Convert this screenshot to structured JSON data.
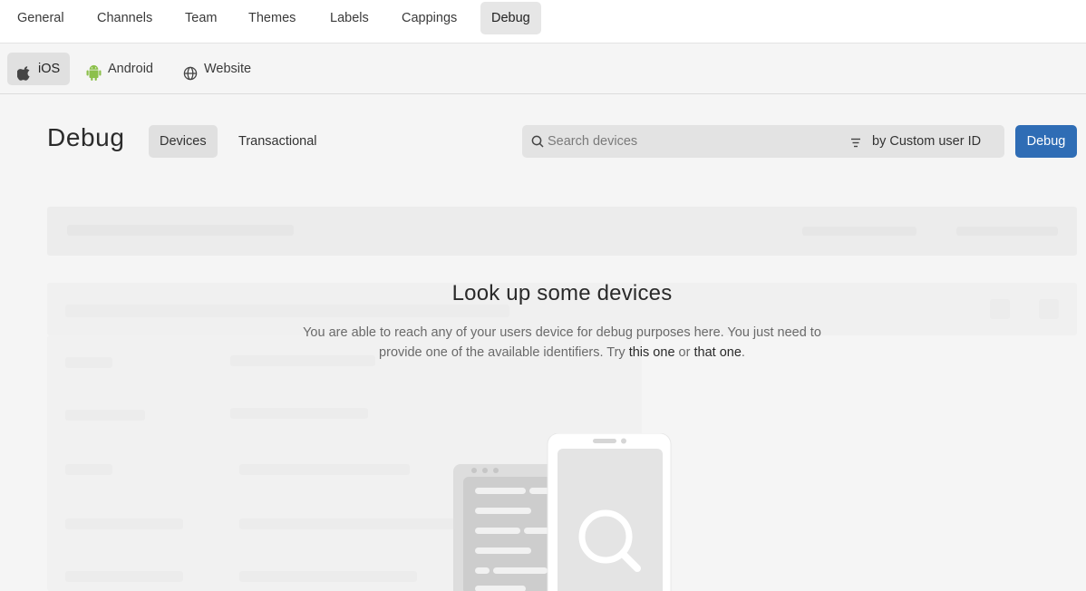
{
  "top_tabs": [
    {
      "label": "General",
      "active": false
    },
    {
      "label": "Channels",
      "active": false
    },
    {
      "label": "Team",
      "active": false
    },
    {
      "label": "Themes",
      "active": false
    },
    {
      "label": "Labels",
      "active": false
    },
    {
      "label": "Cappings",
      "active": false
    },
    {
      "label": "Debug",
      "active": true
    }
  ],
  "platform_tabs": [
    {
      "label": "iOS",
      "icon": "apple-icon",
      "active": true
    },
    {
      "label": "Android",
      "icon": "android-icon",
      "active": false
    },
    {
      "label": "Website",
      "icon": "globe-icon",
      "active": false
    }
  ],
  "page": {
    "title": "Debug",
    "subtabs": [
      {
        "label": "Devices",
        "active": true
      },
      {
        "label": "Transactional",
        "active": false
      }
    ],
    "search": {
      "placeholder": "Search devices",
      "value": "",
      "filter_label": "by Custom user ID"
    },
    "debug_button": "Debug"
  },
  "empty_state": {
    "title": "Look up some devices",
    "description_1": "You are able to reach any of your users device for debug purposes here. You just need to provide one of the available identifiers. Try",
    "link_1": "this one",
    "between": "or",
    "link_2": "that one",
    "end": "."
  },
  "colors": {
    "accent": "#2f6db5",
    "android": "#8cc04b",
    "background": "#f5f5f5"
  }
}
